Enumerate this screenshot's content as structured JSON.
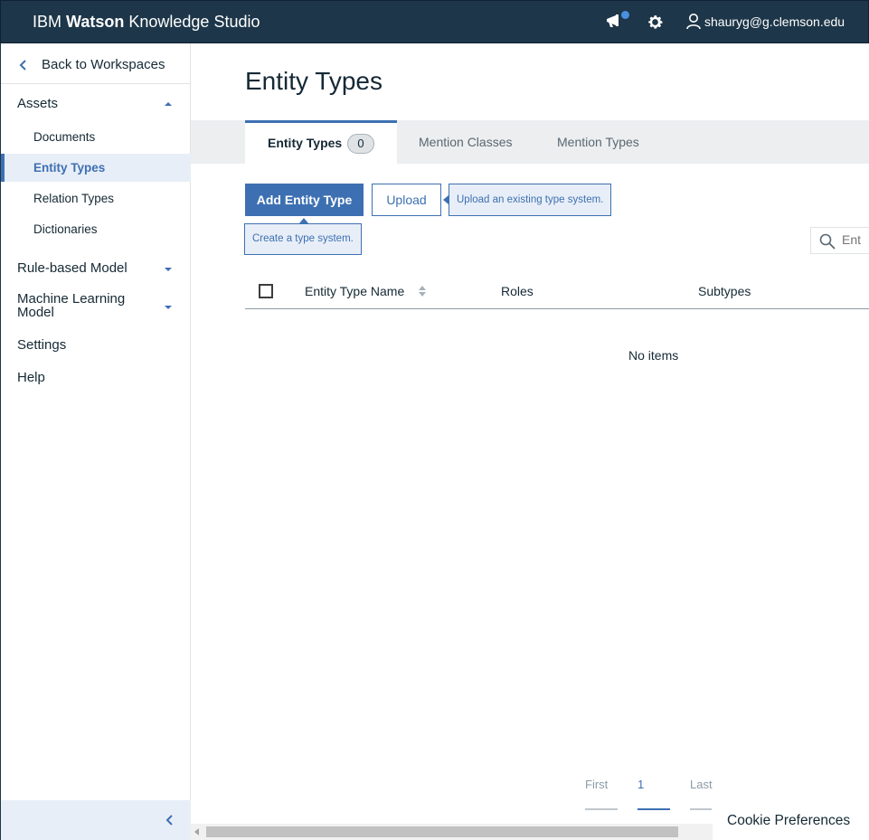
{
  "header": {
    "brand_prefix": "IBM",
    "brand_bold": "Watson",
    "brand_suffix": "Knowledge Studio",
    "user_email": "shauryg@g.clemson.edu",
    "notification_dot_color": "#4a90e2",
    "icons": [
      "megaphone-icon",
      "gear-icon",
      "user-icon"
    ]
  },
  "sidebar": {
    "back_label": "Back to Workspaces",
    "sections": [
      {
        "label": "Assets",
        "expanded": true
      },
      {
        "label": "Rule-based Model",
        "expanded": false
      },
      {
        "label": "Machine Learning",
        "label_line2": "Model",
        "expanded": false
      },
      {
        "label": "Settings"
      },
      {
        "label": "Help"
      }
    ],
    "asset_items": [
      {
        "label": "Documents"
      },
      {
        "label": "Entity Types",
        "active": true
      },
      {
        "label": "Relation Types"
      },
      {
        "label": "Dictionaries"
      }
    ]
  },
  "main": {
    "title": "Entity Types",
    "tabs": [
      {
        "label": "Entity Types",
        "count": "0",
        "active": true
      },
      {
        "label": "Mention Classes"
      },
      {
        "label": "Mention Types"
      }
    ],
    "add_button": "Add Entity Type",
    "upload_button": "Upload",
    "upload_tooltip": "Upload an existing type system.",
    "create_tooltip": "Create a type system.",
    "search_placeholder": "Ent",
    "table": {
      "columns": [
        "Entity Type Name",
        "Roles",
        "Subtypes"
      ],
      "empty_text": "No items"
    },
    "pagination": {
      "first": "First",
      "current": "1",
      "last": "Last"
    }
  },
  "cookie_label": "Cookie Preferences",
  "colors": {
    "accent": "#3d70b2",
    "header_bg": "#1d3649",
    "tab_bar_bg": "#eceef0",
    "active_bg": "#e8eef7"
  }
}
